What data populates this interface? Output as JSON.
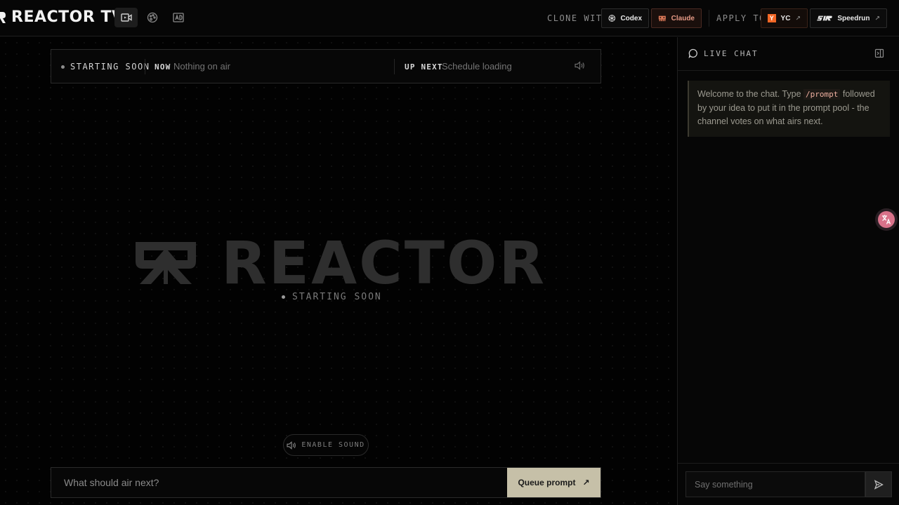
{
  "header": {
    "brand": "REACTOR TV",
    "nav": [
      {
        "icon": "video-camera-icon",
        "active": true
      },
      {
        "icon": "palette-icon",
        "active": false
      },
      {
        "icon": "ad-icon",
        "active": false
      }
    ],
    "clone_label": "CLONE WITH",
    "clone_options": [
      {
        "label": "Codex",
        "icon": "codex-icon"
      },
      {
        "label": "Claude",
        "icon": "claude-icon"
      }
    ],
    "apply_label": "APPLY TO",
    "apply_options": [
      {
        "label": "YC",
        "badge": "Y"
      },
      {
        "label": "Speedrun"
      }
    ]
  },
  "ticker": {
    "status": "STARTING SOON",
    "now_label": "NOW",
    "now_value": "Nothing on air",
    "next_label": "UP NEXT",
    "next_value": "Schedule loading"
  },
  "stage": {
    "logo_text": "REACTOR",
    "status": "STARTING SOON",
    "sound_button": "ENABLE SOUND"
  },
  "prompt": {
    "placeholder": "What should air next?",
    "button": "Queue prompt"
  },
  "chat": {
    "title": "LIVE CHAT",
    "welcome_before": "Welcome to the chat. Type ",
    "welcome_code": "/prompt",
    "welcome_after": " followed by your idea to put it in the prompt pool - the channel votes on what airs next.",
    "input_placeholder": "Say something"
  },
  "colors": {
    "accent": "#c6c0a8",
    "yc_orange": "#f26625",
    "claude": "#d97757"
  }
}
